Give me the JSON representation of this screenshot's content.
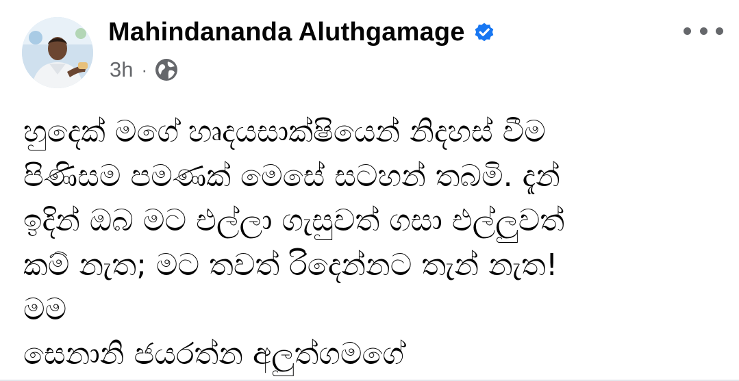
{
  "author": {
    "name": "Mahindananda Aluthgamage",
    "verified": true,
    "avatar_icon": "profile-photo"
  },
  "meta": {
    "timestamp": "3h",
    "separator": "·",
    "audience_icon": "globe-icon"
  },
  "actions": {
    "more_icon": "more-options-icon"
  },
  "post": {
    "lines": [
      "හුදෙක් මගේ හෘදයසාක්ෂියෙන් නිදහස් වීම",
      "පිණිසම පමණක් මෙසේ සටහන් තබමි. දැන්",
      "ඉදින් ඔබ මට එල්ලා ගැසුවත් ගසා එල්ලුවත්",
      "කම් නැත; මට තවත් රිදෙන්නට තැන් නැත!",
      "මම",
      "සෙනානි ජයරත්න අලුත්ගමගේ"
    ]
  },
  "colors": {
    "name": "#050505",
    "meta": "#65676b",
    "verified": "#1877f2",
    "background": "#ffffff"
  }
}
